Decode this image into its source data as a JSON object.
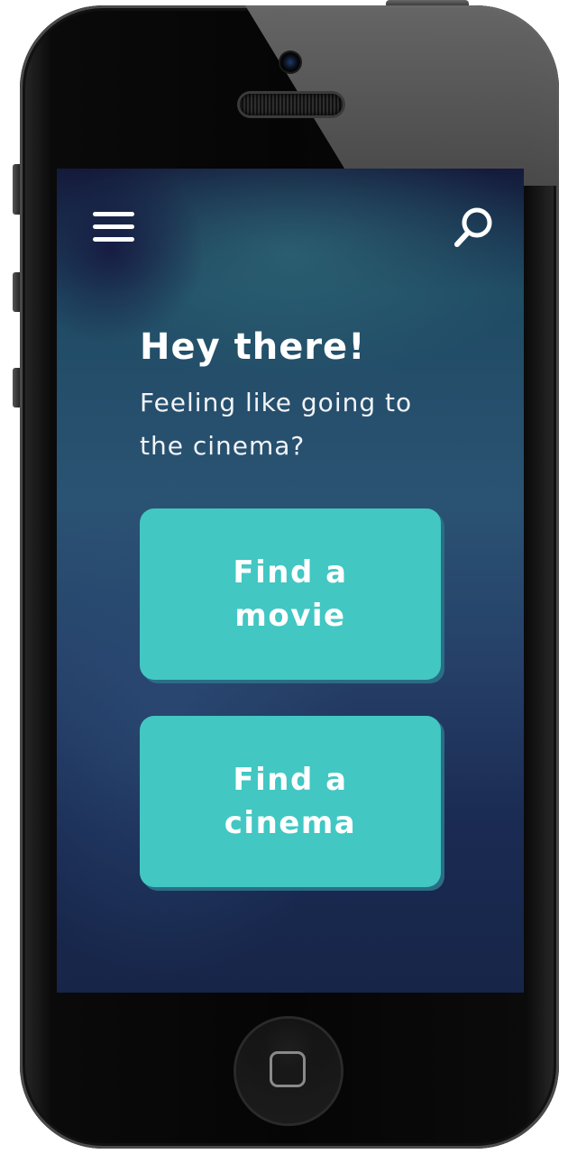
{
  "header": {
    "menu_icon": "hamburger-menu-icon",
    "search_icon": "search-icon"
  },
  "main": {
    "greeting": "Hey there!",
    "subtitle": "Feeling like going to the cinema?",
    "actions": [
      {
        "label": "Find a movie"
      },
      {
        "label": "Find a cinema"
      }
    ]
  },
  "colors": {
    "accent": "#42c7c3",
    "background_top": "#141a3a",
    "background_mid": "#2a5373",
    "background_bottom": "#172548",
    "text": "#ffffff"
  }
}
